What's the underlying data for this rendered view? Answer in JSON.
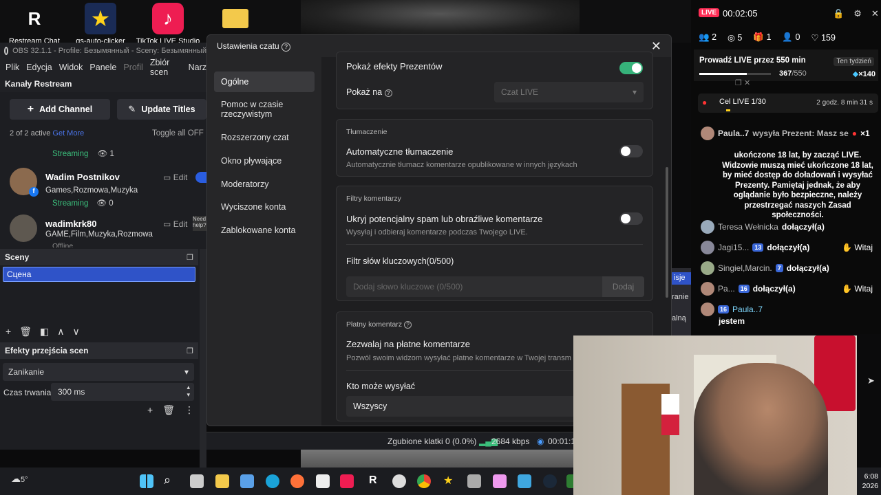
{
  "desktop": {
    "icons": [
      {
        "label": "Restream Chat"
      },
      {
        "label": "qs-auto-clicker"
      },
      {
        "label": "TikTok LIVE Studio"
      }
    ]
  },
  "obs": {
    "title": "OBS 32.1.1 - Profile: Безымянный - Sceny: Безымянный",
    "menu": [
      "Plik",
      "Edycja",
      "Widok",
      "Panele",
      "Profil",
      "Zbiór scen",
      "Narz"
    ],
    "restream": {
      "header": "Kanały Restream",
      "add_channel": "Add Channel",
      "update_titles": "Update Titles",
      "active": "2 of 2 active",
      "get_more": "Get More",
      "toggle_all": "Toggle all OFF",
      "first_status": "Streaming",
      "first_viewers": "1",
      "channels": [
        {
          "name": "Wadim Postnikov",
          "categories": "Games,Rozmowa,Muzyka",
          "status": "Streaming",
          "viewers": "0",
          "edit": "Edit"
        },
        {
          "name": "wadimkrk80",
          "categories": "GAME,Film,Muzyka,Rozmowa",
          "status": "Offline",
          "edit": "Edit",
          "help": "Need help?"
        }
      ]
    },
    "scenes": {
      "header": "Sceny",
      "items": [
        "Сцена"
      ]
    },
    "transitions": {
      "header": "Efekty przejścia scen",
      "selected": "Zanikanie",
      "duration_label": "Czas trwania",
      "duration_value": "300 ms"
    },
    "status": {
      "dropped": "Zgubione klatki 0 (0.0%)",
      "bitrate": "2684 kbps",
      "time": "00:01:1"
    }
  },
  "dialog": {
    "title": "Ustawienia czatu",
    "nav": [
      "Ogólne",
      "Pomoc w czasie rzeczywistym",
      "Rozszerzony czat",
      "Okno pływające",
      "Moderatorzy",
      "Wyciszone konta",
      "Zablokowane konta"
    ],
    "nav_active": 0,
    "gifts": {
      "label": "Pokaż efekty Prezentów",
      "on": true,
      "show_on_label": "Pokaż na",
      "show_on_value": "Czat LIVE"
    },
    "translation": {
      "header": "Tłumaczenie",
      "label": "Automatyczne tłumaczenie",
      "sub": "Automatycznie tłumacz komentarze opublikowane w innych językach",
      "on": false
    },
    "filters": {
      "header": "Filtry komentarzy",
      "spam_label": "Ukryj potencjalny spam lub obraźliwe komentarze",
      "spam_sub": "Wysyłaj i odbieraj komentarze podczas Twojego LIVE.",
      "spam_on": false,
      "keyword_label": "Filtr słów kluczowych(0/500)",
      "keyword_placeholder": "Dodaj słowo kluczowe (0/500)",
      "add_button": "Dodaj"
    },
    "paid": {
      "header": "Płatny komentarz",
      "label": "Zezwalaj na płatne komentarze",
      "sub": "Pozwól swoim widzom wysyłać płatne komentarze w Twojej transm",
      "who_label": "Kto może wysyłać",
      "who_value": "Wszyscy"
    }
  },
  "live": {
    "badge": "LIVE",
    "timer": "00:02:05",
    "stats": {
      "viewers": "2",
      "users": "5",
      "gifts": "1",
      "shares": "0",
      "likes": "159"
    },
    "goal_title": "Prowadź LIVE przez 550 min",
    "goal_week": "Ten tydzień",
    "goal_progress": "367",
    "goal_total": "/550",
    "goal_progress_fraction": 0.667,
    "goal_reward": "×140",
    "cel_label": "Cel LIVE",
    "cel_value": "1/30",
    "cel_time": "2 godz. 8 min 31 s",
    "gift_user": "Paula..7",
    "gift_text": "wysyła Prezent: Masz se",
    "gift_count": "×1",
    "notice": "ukończone 18 lat, by zacząć LIVE. Widzowie muszą mieć ukończone 18 lat, by mieć dostęp do doładowań i wysyłać Prezenty. Pamiętaj jednak, że aby oglądanie było bezpieczne, należy przestrzegać naszych Zasad społeczności.",
    "events": [
      {
        "user": "Teresa Wełnicka",
        "text": "dołączył(a)"
      },
      {
        "user": "Jagi15...",
        "level": "13",
        "text": "dołączył(a)",
        "action": "Witaj"
      },
      {
        "user": "Singiel,Marcin.",
        "level": "7",
        "text": "dołączył(a)"
      },
      {
        "user": "Pa...",
        "level": "16",
        "text": "dołączył(a)",
        "action": "Witaj"
      },
      {
        "user": "Paula..7",
        "level": "16",
        "text": "jestem"
      }
    ],
    "side_tabs": [
      "isje",
      "ranie",
      "alną"
    ]
  },
  "taskbar": {
    "weather": "5°",
    "time": "6:08",
    "date": "2026"
  }
}
